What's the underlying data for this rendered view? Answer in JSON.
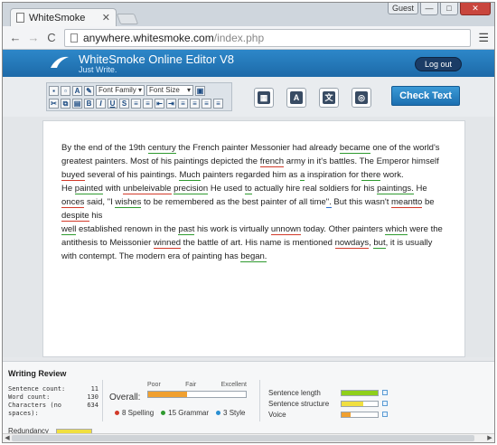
{
  "browser": {
    "tab_title": "WhiteSmoke",
    "tab_close": "✕",
    "user_badge": "Guest",
    "win_min": "—",
    "win_max": "□",
    "win_close": "✕",
    "url_host": "anywhere.whitesmoke.com",
    "url_path": "/index.php"
  },
  "app": {
    "title": "WhiteSmoke Online Editor V8",
    "tagline": "Just Write.",
    "logout_label": "Log out",
    "check_button": "Check Text",
    "font_family_label": "Font Family",
    "font_size_label": "Font Size"
  },
  "editor": {
    "segments": [
      {
        "t": "By the end of the 19th "
      },
      {
        "t": "century",
        "u": "g"
      },
      {
        "t": " the French painter Messonier had already "
      },
      {
        "t": "became",
        "u": "g"
      },
      {
        "t": " one of the world's greatest painters. Most of his paintings depicted the "
      },
      {
        "t": "french",
        "u": "r"
      },
      {
        "t": " army in it's battles. The Emperor himself "
      },
      {
        "t": "buyed",
        "u": "r"
      },
      {
        "t": " several of his paintings. "
      },
      {
        "t": "Much",
        "u": "g"
      },
      {
        "t": " painters regarded him as "
      },
      {
        "t": "a",
        "u": "g"
      },
      {
        "t": " inspiration for "
      },
      {
        "t": "there",
        "u": "g"
      },
      {
        "t": " work."
      },
      {
        "br": true
      },
      {
        "t": "He "
      },
      {
        "t": "painted",
        "u": "g"
      },
      {
        "t": " with "
      },
      {
        "t": "unbeleivable",
        "u": "r"
      },
      {
        "t": " "
      },
      {
        "t": "precision",
        "u": "g"
      },
      {
        "t": " He used "
      },
      {
        "t": "to",
        "u": "g"
      },
      {
        "t": " actually hire real soldiers for his "
      },
      {
        "t": "paintings.",
        "u": "g"
      },
      {
        "t": " He "
      },
      {
        "t": "onces",
        "u": "r"
      },
      {
        "t": " said, \"I "
      },
      {
        "t": "wishes",
        "u": "g"
      },
      {
        "t": " to be remembered as the best painter of all time"
      },
      {
        "t": "\".",
        "u": "b"
      },
      {
        "t": " But this wasn't "
      },
      {
        "t": "meantto",
        "u": "r"
      },
      {
        "t": " be "
      },
      {
        "t": "despite",
        "u": "r"
      },
      {
        "t": " his"
      },
      {
        "br": true
      },
      {
        "t": "well",
        "u": "g"
      },
      {
        "t": " established renown in the "
      },
      {
        "t": "past",
        "u": "g"
      },
      {
        "t": " his work is virtually "
      },
      {
        "t": "unnown",
        "u": "r"
      },
      {
        "t": " today. Other painters "
      },
      {
        "t": "which",
        "u": "g"
      },
      {
        "t": " were the antithesis to Meissonier "
      },
      {
        "t": "winned",
        "u": "r"
      },
      {
        "t": " the battle of art. His name is mentioned "
      },
      {
        "t": "nowdays",
        "u": "r"
      },
      {
        "t": ", "
      },
      {
        "t": "but",
        "u": "g"
      },
      {
        "t": ", it is usually with contempt. The modern era of painting has "
      },
      {
        "t": "began.",
        "u": "g"
      }
    ]
  },
  "review": {
    "title": "Writing Review",
    "stats": [
      {
        "label": "Sentence count:",
        "value": "11"
      },
      {
        "label": "Word count:",
        "value": "130"
      },
      {
        "label": "Characters (no spaces):",
        "value": "634"
      }
    ],
    "overall_label": "Overall:",
    "scale": [
      "Poor",
      "Fair",
      "Excellent"
    ],
    "overall_level": 0.4,
    "legend": [
      {
        "text": "8 Spelling",
        "color": "#d23a2a"
      },
      {
        "text": "15 Grammar",
        "color": "#2f9a2f"
      },
      {
        "text": "3 Style",
        "color": "#2a8fd2"
      }
    ],
    "metrics": [
      {
        "label": "Sentence length",
        "level": 1.0,
        "color": "#8fcf1a"
      },
      {
        "label": "Sentence structure",
        "level": 0.6,
        "color": "#f0df40"
      },
      {
        "label": "Voice",
        "level": 0.25,
        "color": "#f0a030"
      }
    ],
    "redundancy_label": "Redundancy"
  }
}
